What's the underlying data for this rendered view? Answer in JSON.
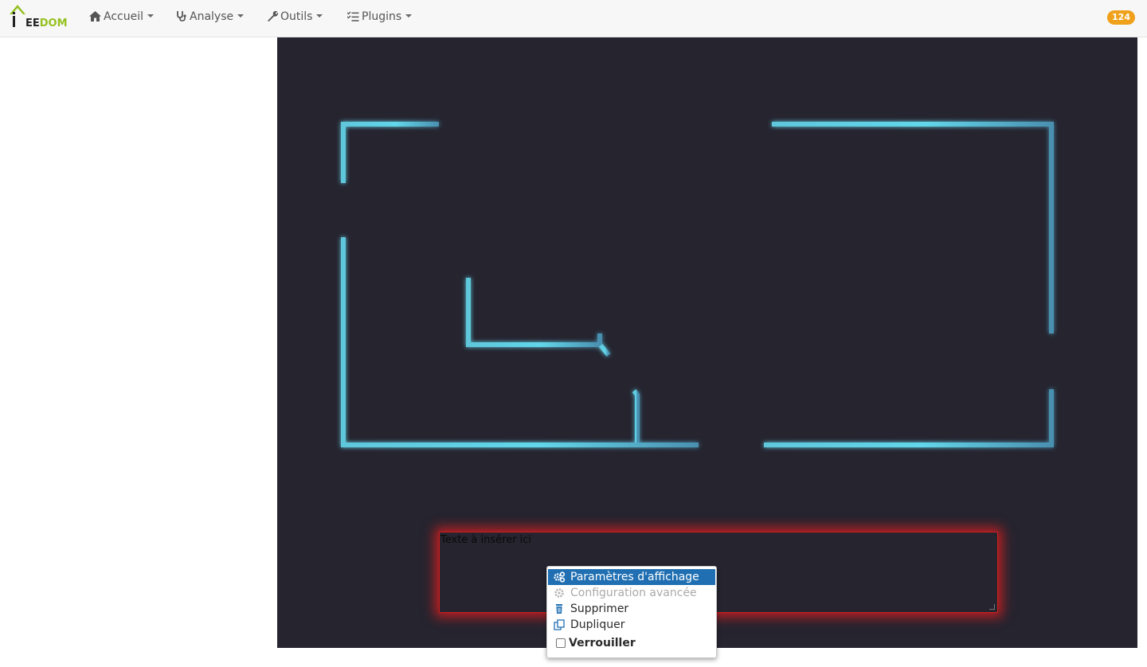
{
  "logo": {
    "text_part1": "EE",
    "text_part2": "DOM"
  },
  "navbar": {
    "items": [
      {
        "label": "Accueil",
        "icon": "home-icon"
      },
      {
        "label": "Analyse",
        "icon": "stethoscope-icon"
      },
      {
        "label": "Outils",
        "icon": "wrench-icon"
      },
      {
        "label": "Plugins",
        "icon": "tasks-icon"
      }
    ],
    "notification_count": "124"
  },
  "design": {
    "text_widget": {
      "text": "Texte à insérer ici"
    }
  },
  "context_menu": {
    "items": [
      {
        "label": "Paramètres d'affichage",
        "icon": "cogs-icon",
        "state": "active"
      },
      {
        "label": "Configuration avancée",
        "icon": "gear-icon",
        "state": "disabled"
      },
      {
        "label": "Supprimer",
        "icon": "trash-icon",
        "state": "normal"
      },
      {
        "label": "Dupliquer",
        "icon": "copy-icon",
        "state": "normal"
      },
      {
        "label": "Verrouiller",
        "icon": "checkbox",
        "state": "unchecked"
      }
    ]
  },
  "colors": {
    "design_background": "#25242f",
    "wall_color": "#5fd3e8",
    "text_zone_glow": "#d01e1e",
    "menu_active": "#1f6fb2",
    "badge": "#f0a11b",
    "logo_green": "#94c11f"
  }
}
